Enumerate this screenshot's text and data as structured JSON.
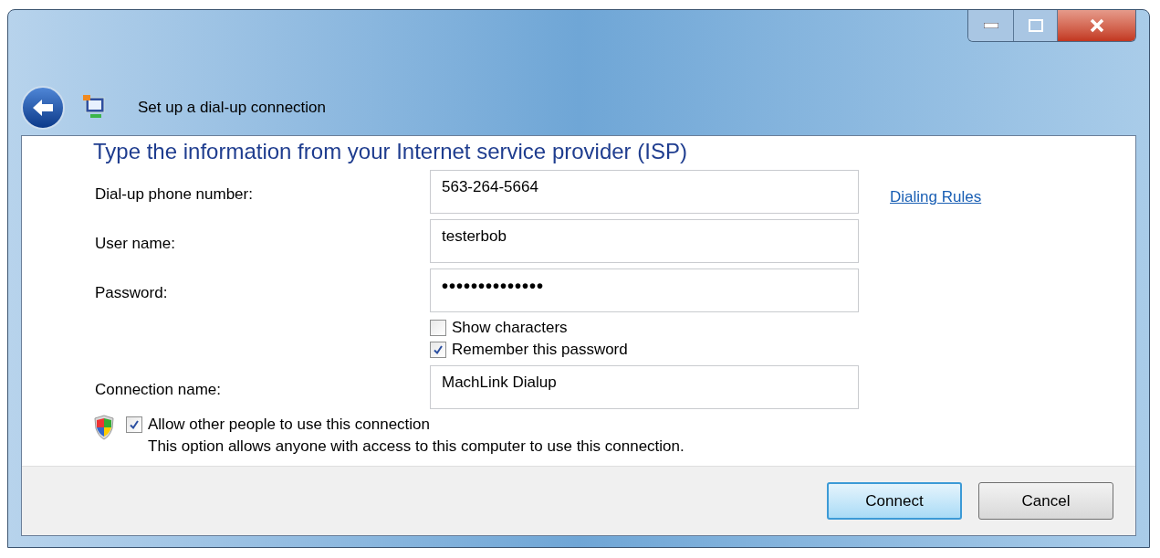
{
  "window": {
    "title": "Set up a dial-up connection"
  },
  "heading": "Type the information from your Internet service provider (ISP)",
  "fields": [
    {
      "label": "Dial-up phone number:",
      "value": "563-264-5664",
      "kind": "text",
      "link": "Dialing Rules"
    },
    {
      "label": "User name:",
      "value": "testerbob",
      "kind": "text"
    },
    {
      "label": "Password:",
      "value": "••••••••••••••",
      "kind": "password"
    },
    {
      "kind": "checks",
      "options": [
        {
          "label": "Show characters",
          "checked": false
        },
        {
          "label": "Remember this password",
          "checked": true
        }
      ]
    },
    {
      "label": "Connection name:",
      "value": "MachLink Dialup",
      "kind": "text"
    }
  ],
  "share": {
    "label": "Allow other people to use this connection",
    "checked": true,
    "description": "This option allows anyone with access to this computer to use this connection."
  },
  "buttons": [
    {
      "label": "Connect",
      "default": true
    },
    {
      "label": "Cancel",
      "default": false
    }
  ]
}
